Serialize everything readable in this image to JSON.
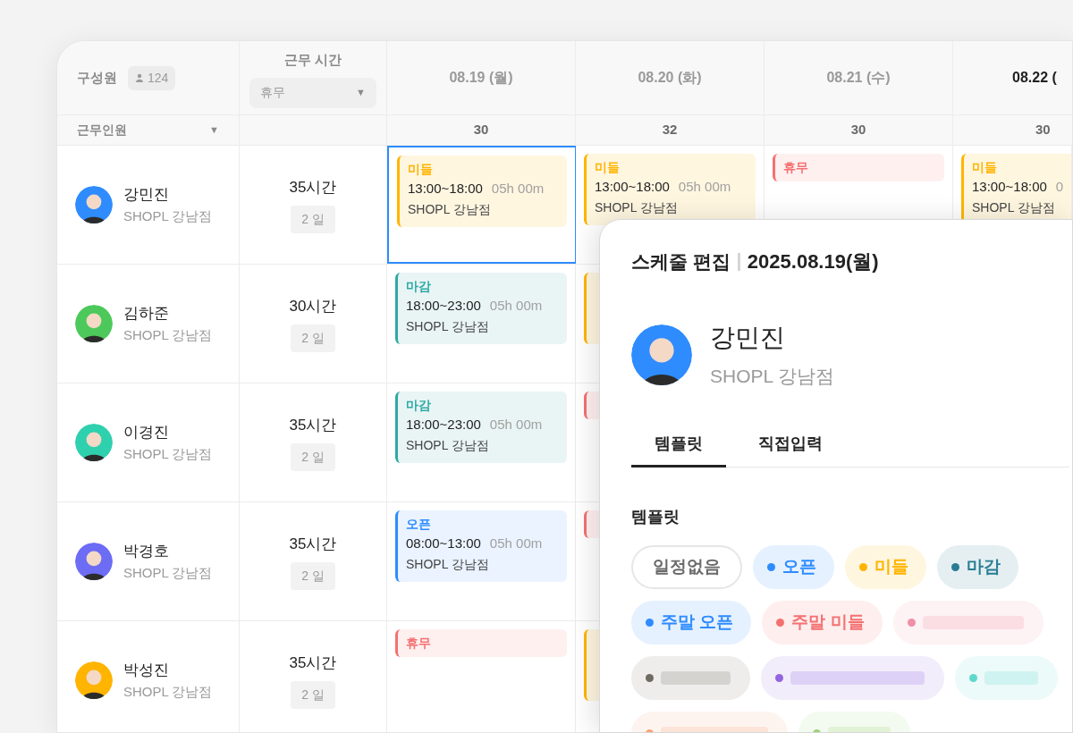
{
  "header": {
    "member": "구성원",
    "member_count": "124",
    "hours": "근무 시간",
    "hours_filter": "휴무",
    "staff_filter": "근무인원",
    "caret": "▼"
  },
  "days": [
    {
      "date": "08.19 (월)",
      "count": "30",
      "today": false
    },
    {
      "date": "08.20 (화)",
      "count": "32",
      "today": false
    },
    {
      "date": "08.21 (수)",
      "count": "30",
      "today": false
    },
    {
      "date": "08.22 (",
      "count": "30",
      "today": true
    }
  ],
  "rows": [
    {
      "name": "강민진",
      "branch": "SHOPL 강남점",
      "color": "#2e8cff",
      "hours": "35시간",
      "days": "2 일",
      "shifts": [
        {
          "kind": "middle",
          "label": "미들",
          "time": "13:00~18:00",
          "duration": "05h 00m",
          "place": "SHOPL 강남점",
          "selected": true
        },
        {
          "kind": "middle",
          "label": "미들",
          "time": "13:00~18:00",
          "duration": "05h 00m",
          "place": "SHOPL 강남점",
          "selected": false
        },
        {
          "kind": "off",
          "label": "휴무",
          "selected": false
        },
        {
          "kind": "middle",
          "label": "미들",
          "time": "13:00~18:00",
          "duration": "0",
          "place": "SHOPL 강남점",
          "selected": false
        }
      ]
    },
    {
      "name": "김하준",
      "branch": "SHOPL 강남점",
      "color": "#4cc95a",
      "hours": "30시간",
      "days": "2 일",
      "shifts": [
        {
          "kind": "close",
          "label": "마감",
          "time": "18:00~23:00",
          "duration": "05h 00m",
          "place": "SHOPL 강남점",
          "selected": false
        },
        {
          "kind": "middle",
          "selected": false
        }
      ]
    },
    {
      "name": "이경진",
      "branch": "SHOPL 강남점",
      "color": "#2fd0ae",
      "hours": "35시간",
      "days": "2 일",
      "shifts": [
        {
          "kind": "close",
          "label": "마감",
          "time": "18:00~23:00",
          "duration": "05h 00m",
          "place": "SHOPL 강남점",
          "selected": false
        },
        {
          "kind": "off",
          "selected": false
        }
      ]
    },
    {
      "name": "박경호",
      "branch": "SHOPL 강남점",
      "color": "#6c6cf5",
      "hours": "35시간",
      "days": "2 일",
      "shifts": [
        {
          "kind": "open",
          "label": "오픈",
          "time": "08:00~13:00",
          "duration": "05h 00m",
          "place": "SHOPL 강남점",
          "selected": false
        },
        {
          "kind": "off",
          "selected": false
        }
      ]
    },
    {
      "name": "박성진",
      "branch": "SHOPL 강남점",
      "color": "#ffb400",
      "hours": "35시간",
      "days": "2 일",
      "shifts": [
        {
          "kind": "off",
          "label": "휴무",
          "selected": false
        },
        {
          "kind": "middle",
          "selected": false
        }
      ]
    }
  ],
  "editor": {
    "title": "스케줄 편집",
    "date": "2025.08.19(월)",
    "name": "강민진",
    "branch": "SHOPL 강남점",
    "color": "#2e8cff",
    "tabs": [
      {
        "label": "템플릿",
        "selected": true
      },
      {
        "label": "직접입력",
        "selected": false
      }
    ],
    "section": "템플릿",
    "templates": [
      {
        "kind": "empty",
        "label": "일정없음"
      },
      {
        "kind": "tag",
        "label": "오픈",
        "color": "#2e8cff"
      },
      {
        "kind": "tag",
        "label": "미들",
        "color": "#ffb400"
      },
      {
        "kind": "tag",
        "label": "마감",
        "color": "#287c93"
      },
      {
        "kind": "tag",
        "label": "주말 오픈",
        "color": "#2e8cff"
      },
      {
        "kind": "tag",
        "label": "주말 미들",
        "color": "#f47171"
      },
      {
        "kind": "placeholder",
        "color": "#f08fa6"
      },
      {
        "kind": "placeholder",
        "color": "#6f6b60"
      },
      {
        "kind": "placeholder",
        "color": "#9166e0"
      },
      {
        "kind": "placeholder",
        "color": "#5fd8cc"
      },
      {
        "kind": "placeholder",
        "color": "#f5a27a"
      },
      {
        "kind": "placeholder",
        "color": "#9ad27a"
      }
    ]
  }
}
